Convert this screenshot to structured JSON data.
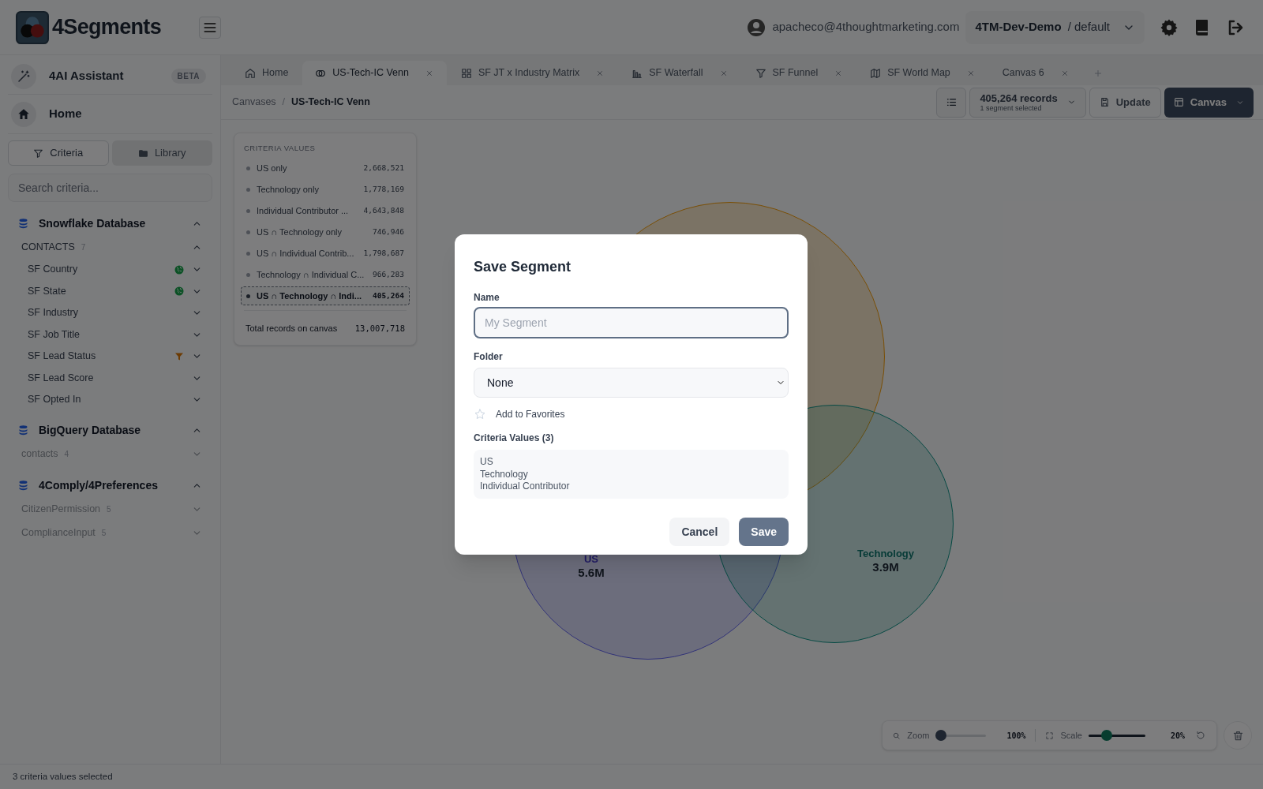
{
  "app": {
    "logo_text": "4Segments"
  },
  "header": {
    "user_email": "apacheco@4thoughtmarketing.com",
    "workspace": "4TM-Dev-Demo",
    "environment": "/ default"
  },
  "sidebar": {
    "assistant": {
      "label": "4AI Assistant",
      "badge": "BETA"
    },
    "home": "Home",
    "view_tabs": [
      {
        "label": "Criteria",
        "selected": true
      },
      {
        "label": "Library",
        "selected": false
      }
    ],
    "search_placeholder": "Search criteria...",
    "databases": [
      {
        "name": "Snowflake Database",
        "expanded": true,
        "tables": [
          {
            "name": "CONTACTS",
            "count": "7",
            "disabled": false,
            "expanded": true,
            "fields": [
              {
                "name": "SF Country",
                "kind": "geo"
              },
              {
                "name": "SF State",
                "kind": "geo"
              },
              {
                "name": "SF Industry",
                "kind": "plain"
              },
              {
                "name": "SF Job Title",
                "kind": "plain"
              },
              {
                "name": "SF Lead Status",
                "kind": "filtered"
              },
              {
                "name": "SF Lead Score",
                "kind": "plain"
              },
              {
                "name": "SF Opted In",
                "kind": "plain"
              }
            ]
          }
        ]
      },
      {
        "name": "BigQuery Database",
        "expanded": true,
        "tables": [
          {
            "name": "contacts",
            "count": "4",
            "disabled": true,
            "expanded": false
          }
        ]
      },
      {
        "name": "4Comply/4Preferences",
        "expanded": true,
        "tables": [
          {
            "name": "CitizenPermission",
            "count": "5",
            "disabled": true,
            "expanded": false
          },
          {
            "name": "ComplianceInput",
            "count": "5",
            "disabled": true,
            "expanded": false
          }
        ]
      }
    ]
  },
  "tabs": [
    {
      "label": "Home",
      "kind": "home",
      "selected": false,
      "closable": false
    },
    {
      "label": "US-Tech-IC Venn",
      "kind": "venn",
      "selected": true,
      "closable": true
    },
    {
      "label": "SF JT x Industry Matrix",
      "kind": "matrix",
      "selected": false,
      "closable": true
    },
    {
      "label": "SF Waterfall",
      "kind": "waterfall",
      "selected": false,
      "closable": true
    },
    {
      "label": "SF Funnel",
      "kind": "funnel",
      "selected": false,
      "closable": true
    },
    {
      "label": "SF World Map",
      "kind": "map",
      "selected": false,
      "closable": true
    },
    {
      "label": "Canvas 6",
      "kind": "blank",
      "selected": false,
      "closable": true
    }
  ],
  "breadcrumb": [
    "Canvases",
    "US-Tech-IC Venn"
  ],
  "breadcrumb_separator": "/",
  "toolbar": {
    "records": "405,264 records",
    "records_note": "1 segment selected",
    "update": "Update",
    "canvas": "Canvas"
  },
  "criteria_values": {
    "title": "CRITERIA VALUES",
    "items": [
      {
        "label": "US only",
        "value": "2,668,521",
        "selected": false
      },
      {
        "label": "Technology only",
        "value": "1,778,169",
        "selected": false
      },
      {
        "label": "Individual Contributor ...",
        "value": "4,643,848",
        "selected": false
      },
      {
        "label": "US ∩ Technology only",
        "value": "746,946",
        "selected": false
      },
      {
        "label": "US ∩ Individual Contrib...",
        "value": "1,798,687",
        "selected": false
      },
      {
        "label": "Technology ∩ Individual C...",
        "value": "966,283",
        "selected": false
      },
      {
        "label": "US ∩ Technology ∩ Indi...",
        "value": "405,264",
        "selected": true
      }
    ],
    "total_label": "Total records on canvas",
    "total_value": "13,007,718"
  },
  "venn": {
    "labels": [
      {
        "label": "US",
        "value": "5.6M"
      },
      {
        "label": "Technology",
        "value": "3.9M"
      }
    ]
  },
  "canvas_controls": {
    "zoom": {
      "label": "Zoom",
      "level": 0,
      "reading": "100%"
    },
    "scale": {
      "label": "Scale",
      "level": 0.27,
      "reading": "20%"
    }
  },
  "status_bar": "3 criteria values selected",
  "modal": {
    "title": "Save Segment",
    "name_label": "Name",
    "name_placeholder": "My Segment",
    "folder_label": "Folder",
    "folder_value": "None",
    "favorite": {
      "label": "Add to Favorites",
      "checked": false
    },
    "criteria_label": "Criteria Values (3)",
    "criteria": [
      "US",
      "Technology",
      "Individual Contributor"
    ],
    "cancel": "Cancel",
    "save": "Save"
  }
}
